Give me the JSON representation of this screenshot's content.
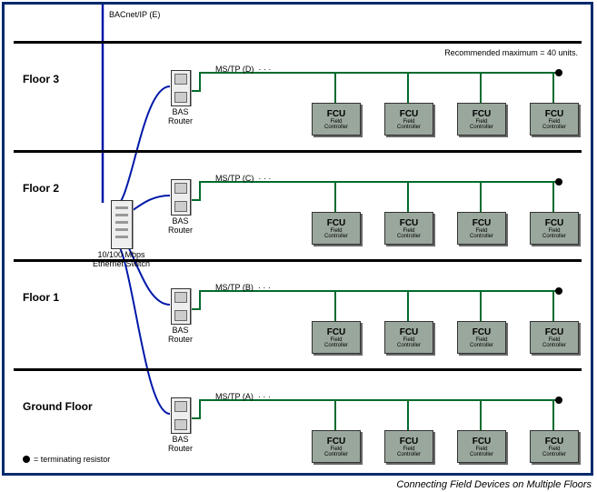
{
  "backbone_label": "BACnet/IP (E)",
  "caption": "Connecting Field Devices on Multiple Floors",
  "switch_label": "10/100 Mbps\nEthernet Switch",
  "bas_label": "BAS\nRouter",
  "fcu_top": "FCU",
  "fcu_sub": "Field\nController",
  "max_note": "Recommended maximum = 40 units.",
  "legend": "=  terminating resistor",
  "dots": "· · ·",
  "floors": [
    {
      "name": "Floor 3",
      "bus": "MS/TP (D)"
    },
    {
      "name": "Floor 2",
      "bus": "MS/TP (C)"
    },
    {
      "name": "Floor 1",
      "bus": "MS/TP (B)"
    },
    {
      "name": "Ground Floor",
      "bus": "MS/TP (A)"
    }
  ]
}
